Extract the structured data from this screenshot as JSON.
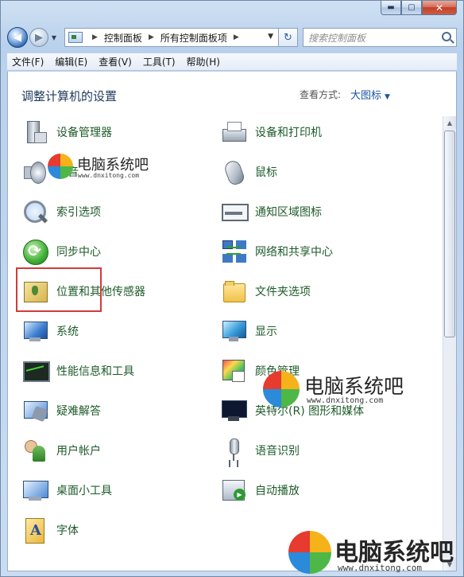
{
  "window": {
    "minimize_glyph": "▬",
    "maximize_glyph": "▢",
    "close_glyph": "✕"
  },
  "address_bar": {
    "crumbs": [
      "控制面板",
      "所有控制面板项"
    ],
    "search_placeholder": "搜索控制面板"
  },
  "menu": [
    "文件(F)",
    "编辑(E)",
    "查看(V)",
    "工具(T)",
    "帮助(H)"
  ],
  "header": {
    "title": "调整计算机的设置",
    "view_by_label": "查看方式:",
    "view_by_value": "大图标"
  },
  "items_left": [
    {
      "label": "设备管理器",
      "icon": "device-manager-icon"
    },
    {
      "label": "声音",
      "icon": "speaker-icon"
    },
    {
      "label": "索引选项",
      "icon": "indexing-magnifier-icon"
    },
    {
      "label": "同步中心",
      "icon": "sync-center-icon"
    },
    {
      "label": "位置和其他传感器",
      "icon": "location-sensor-icon"
    },
    {
      "label": "系统",
      "icon": "system-monitor-icon"
    },
    {
      "label": "性能信息和工具",
      "icon": "performance-monitor-icon"
    },
    {
      "label": "疑难解答",
      "icon": "troubleshooting-icon"
    },
    {
      "label": "用户帐户",
      "icon": "user-accounts-icon"
    },
    {
      "label": "桌面小工具",
      "icon": "desktop-gadgets-icon"
    },
    {
      "label": "字体",
      "icon": "fonts-folder-icon"
    }
  ],
  "items_right": [
    {
      "label": "设备和打印机",
      "icon": "printer-icon"
    },
    {
      "label": "鼠标",
      "icon": "mouse-icon"
    },
    {
      "label": "通知区域图标",
      "icon": "notification-area-icon"
    },
    {
      "label": "网络和共享中心",
      "icon": "network-sharing-icon"
    },
    {
      "label": "文件夹选项",
      "icon": "folder-options-icon"
    },
    {
      "label": "显示",
      "icon": "display-monitor-icon"
    },
    {
      "label": "颜色管理",
      "icon": "color-management-icon"
    },
    {
      "label": "英特尔(R) 图形和媒体",
      "icon": "intel-graphics-icon"
    },
    {
      "label": "语音识别",
      "icon": "microphone-icon"
    },
    {
      "label": "自动播放",
      "icon": "autoplay-icon"
    }
  ],
  "highlighted_item": "系统",
  "watermark": {
    "title": "电脑系统吧",
    "url": "www.dnxitong.com"
  },
  "colors": {
    "item_label": "#1e5b2a",
    "highlight_border": "#d43a3a",
    "title_text": "#1e395b"
  }
}
